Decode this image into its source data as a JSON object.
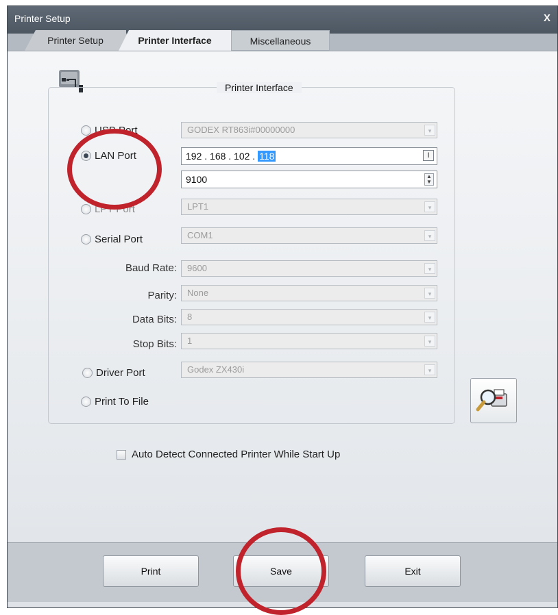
{
  "window": {
    "title": "Printer Setup",
    "close_label": "X"
  },
  "tabs": [
    {
      "label": "Printer Setup",
      "active": false
    },
    {
      "label": "Printer Interface",
      "active": true
    },
    {
      "label": "Miscellaneous",
      "active": false
    }
  ],
  "groupbox": {
    "title": "Printer Interface"
  },
  "ports": {
    "usb": {
      "label": "USB Port",
      "value": "GODEX RT863i#00000000"
    },
    "lan": {
      "label": "LAN Port",
      "ip_prefix": "192 . 168 . 102 .",
      "ip_last": "118",
      "port": "9100"
    },
    "lpt": {
      "label": "LPT Port",
      "value": "LPT1"
    },
    "serial": {
      "label": "Serial Port",
      "value": "COM1"
    },
    "driver": {
      "label": "Driver Port",
      "value": "Godex ZX430i"
    },
    "file": {
      "label": "Print To File"
    }
  },
  "serial_settings": {
    "baud_label": "Baud Rate:",
    "baud_value": "9600",
    "parity_label": "Parity:",
    "parity_value": "None",
    "data_bits_label": "Data Bits:",
    "data_bits_value": "8",
    "stop_bits_label": "Stop Bits:",
    "stop_bits_value": "1"
  },
  "auto_detect": {
    "label": "Auto Detect Connected Printer While Start Up",
    "checked": false
  },
  "buttons": {
    "print": "Print",
    "save": "Save",
    "exit": "Exit"
  },
  "annotation_color": "#c0232b"
}
